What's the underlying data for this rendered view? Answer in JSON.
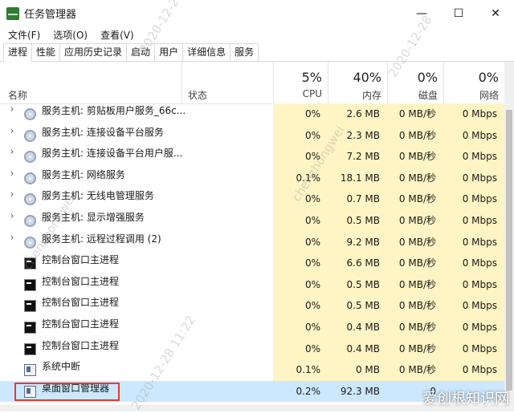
{
  "window": {
    "title": "任务管理器",
    "controls": [
      "—",
      "☐",
      "✕"
    ]
  },
  "menu": [
    "文件(F)",
    "选项(O)",
    "查看(V)"
  ],
  "tabs": [
    "进程",
    "性能",
    "应用历史记录",
    "启动",
    "用户",
    "详细信息",
    "服务"
  ],
  "header": {
    "name": "名称",
    "status": "状态",
    "cpu": {
      "pct": "5%",
      "label": "CPU"
    },
    "memory": {
      "pct": "40%",
      "label": "内存"
    },
    "disk": {
      "pct": "0%",
      "label": "磁盘"
    },
    "network": {
      "pct": "0%",
      "label": "网络"
    }
  },
  "rows": [
    {
      "name": "服务主机: 剪贴板用户服务_66c...",
      "cpu": "0%",
      "mem": "2.6 MB",
      "disk": "0 MB/秒",
      "net": "0 Mbps",
      "icon": "gear-icon",
      "expand": true
    },
    {
      "name": "服务主机: 连接设备平台服务",
      "cpu": "0%",
      "mem": "2.3 MB",
      "disk": "0 MB/秒",
      "net": "0 Mbps",
      "icon": "gear-icon",
      "expand": true
    },
    {
      "name": "服务主机: 连接设备平台用户服...",
      "cpu": "0%",
      "mem": "7.2 MB",
      "disk": "0 MB/秒",
      "net": "0 Mbps",
      "icon": "gear-icon",
      "expand": true
    },
    {
      "name": "服务主机: 网络服务",
      "cpu": "0.1%",
      "mem": "18.1 MB",
      "disk": "0 MB/秒",
      "net": "0 Mbps",
      "icon": "gear-icon",
      "expand": true
    },
    {
      "name": "服务主机: 无线电管理服务",
      "cpu": "0%",
      "mem": "0.7 MB",
      "disk": "0 MB/秒",
      "net": "0 Mbps",
      "icon": "gear-icon",
      "expand": true
    },
    {
      "name": "服务主机: 显示增强服务",
      "cpu": "0%",
      "mem": "0.5 MB",
      "disk": "0 MB/秒",
      "net": "0 Mbps",
      "icon": "gear-icon",
      "expand": true
    },
    {
      "name": "服务主机: 远程过程调用 (2)",
      "cpu": "0%",
      "mem": "9.2 MB",
      "disk": "0 MB/秒",
      "net": "0 Mbps",
      "icon": "gear-icon",
      "expand": true
    },
    {
      "name": "控制台窗口主进程",
      "cpu": "0%",
      "mem": "6.6 MB",
      "disk": "0 MB/秒",
      "net": "0 Mbps",
      "icon": "console-icon",
      "expand": false
    },
    {
      "name": "控制台窗口主进程",
      "cpu": "0%",
      "mem": "0.5 MB",
      "disk": "0 MB/秒",
      "net": "0 Mbps",
      "icon": "console-icon",
      "expand": false
    },
    {
      "name": "控制台窗口主进程",
      "cpu": "0%",
      "mem": "0.5 MB",
      "disk": "0 MB/秒",
      "net": "0 Mbps",
      "icon": "console-icon",
      "expand": false
    },
    {
      "name": "控制台窗口主进程",
      "cpu": "0%",
      "mem": "0.4 MB",
      "disk": "0 MB/秒",
      "net": "0 Mbps",
      "icon": "console-icon",
      "expand": false
    },
    {
      "name": "控制台窗口主进程",
      "cpu": "0%",
      "mem": "0.4 MB",
      "disk": "0 MB/秒",
      "net": "0 Mbps",
      "icon": "console-icon",
      "expand": false
    },
    {
      "name": "系统中断",
      "cpu": "0.1%",
      "mem": "0 MB",
      "disk": "0 MB/秒",
      "net": "0 Mbps",
      "icon": "system-icon",
      "expand": false
    },
    {
      "name": "桌面窗口管理器",
      "cpu": "0.2%",
      "mem": "92.3 MB",
      "disk": "0",
      "net": "",
      "icon": "system-icon",
      "expand": false,
      "selected": true
    }
  ],
  "watermarks": [
    "2020-12-28",
    "chenzhongwei",
    "2020-12-28  11:22"
  ],
  "corner_watermark": "爱创根知识网"
}
